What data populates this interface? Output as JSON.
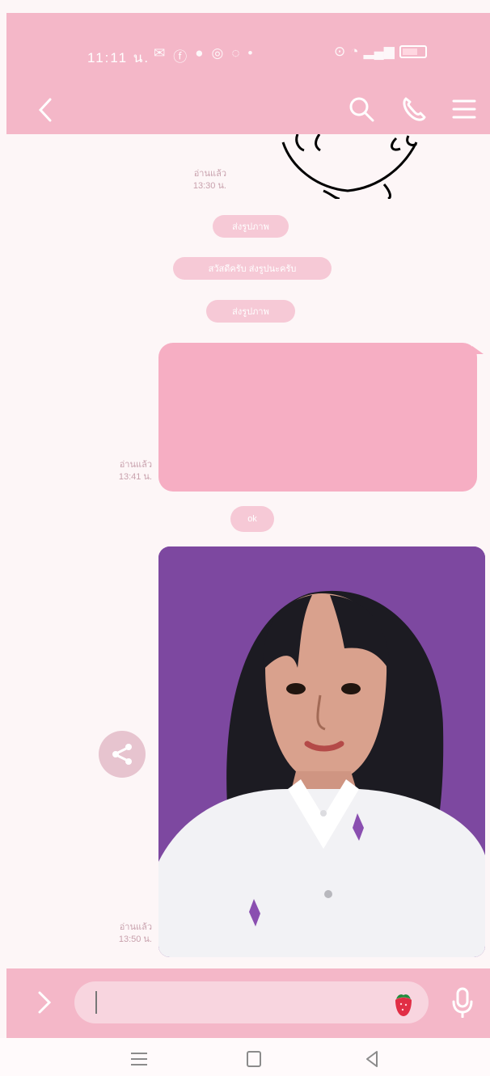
{
  "status_bar": {
    "time": "11:11 น.",
    "battery_label": "52"
  },
  "header": {
    "back_icon": "chevron-left-icon",
    "search_icon": "search-icon",
    "call_icon": "phone-icon",
    "menu_icon": "hamburger-menu-icon"
  },
  "messages": {
    "meta_1": {
      "read": "อ่านแล้ว",
      "time": "13:30 น."
    },
    "pill_1": "ส่งรูปภาพ",
    "pill_2": "สวัสดีครับ ส่งรูปนะครับ",
    "pill_3": "ส่งรูปภาพ",
    "meta_2": {
      "read": "อ่านแล้ว",
      "time": "13:41 น."
    },
    "pill_4": "ok",
    "meta_3": {
      "read": "อ่านแล้ว",
      "time": "13:50 น."
    }
  },
  "input": {
    "placeholder": "",
    "expand_icon": "chevron-right-icon",
    "sticker_icon": "strawberry-icon",
    "mic_icon": "microphone-icon"
  },
  "colors": {
    "header_bg": "#f4b7c8",
    "chat_bg": "#fdf6f7",
    "bubble": "#f6aec3",
    "photo_bg": "#7d48a0"
  }
}
